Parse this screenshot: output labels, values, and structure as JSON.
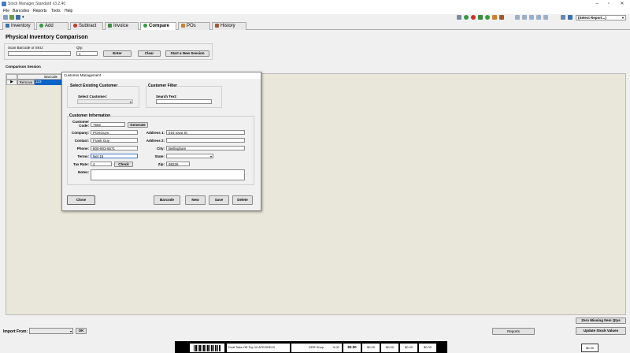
{
  "window": {
    "title": "Stock Manager Standard v3.2.40"
  },
  "menu": [
    "File",
    "Barcodes",
    "Reports",
    "Tools",
    "Help"
  ],
  "toolbar": {
    "report_select": "(Select Report...)"
  },
  "tabs": [
    {
      "label": "Inventory",
      "icon": "inventory-icon",
      "color": "#3a6ea5"
    },
    {
      "label": "Add",
      "icon": "add-icon",
      "color": "#2e9e3e"
    },
    {
      "label": "Subtract",
      "icon": "subtract-icon",
      "color": "#d03030"
    },
    {
      "label": "Invoice",
      "icon": "invoice-icon",
      "color": "#3c8c3c"
    },
    {
      "label": "Compare",
      "icon": "compare-icon",
      "color": "#2ea03a"
    },
    {
      "label": "POs",
      "icon": "pos-icon",
      "color": "#d08030"
    },
    {
      "label": "History",
      "icon": "history-icon",
      "color": "#a05a2a"
    }
  ],
  "compare": {
    "title": "Physical Inventory Comparison",
    "scan_label": "Scan Barcode or SKU:",
    "qty_label": "Qty:",
    "qty_value": "1",
    "enter_button": "Enter",
    "clear_button": "Clear",
    "start_button": "Start a New Session",
    "session_label": "Comparison Session"
  },
  "grid": {
    "headers": [
      "",
      "Barcode"
    ],
    "row": {
      "remove": "Remove",
      "barcode": "123"
    }
  },
  "dialog": {
    "title": "Customer Management",
    "select_existing": "Select Existing Customer",
    "select_customer_label": "Select Customer:",
    "customer_filter": "Customer Filter",
    "search_text_label": "Search Text:",
    "info_title": "Customer Information",
    "labels": {
      "code": "Customer Code:",
      "company": "Company:",
      "contact": "Contact:",
      "phone": "Phone:",
      "terms": "Terms:",
      "tax_rate": "Tax Rate:",
      "notes": "Notes:",
      "address1": "Address 1:",
      "address2": "Address 2:",
      "city": "City:",
      "state": "State:",
      "zip": "Zip:"
    },
    "values": {
      "code": "7552",
      "company": "POSGuys",
      "contact": "Frank Guy",
      "phone": "800-903-6571",
      "terms": "Net 15",
      "tax_rate": "4",
      "notes": "",
      "address1": "516 Iowa St",
      "address2": "",
      "city": "Bellingham",
      "state": "",
      "zip": "98226"
    },
    "buttons": {
      "generate": "Generate",
      "check": "Check",
      "close": "Close",
      "barcode": "Barcode",
      "new": "New",
      "save": "Save",
      "delete": "Delete"
    }
  },
  "bottom": {
    "import_label": "Import From:",
    "ok_button": "OK",
    "reports_button": "Reports",
    "zero_button": "Zero Missing Item Qtys",
    "update_button": "Update Stock Values"
  },
  "statusbar": {
    "item_name": "Dual Take-Off Top 10 ATE2WD10",
    "shop": "DRR Shop",
    "amount": "5.00",
    "total": "$0.00",
    "cells": [
      "$0.00",
      "$0.00",
      "$0.00",
      "$0.00",
      "$0.00"
    ]
  }
}
